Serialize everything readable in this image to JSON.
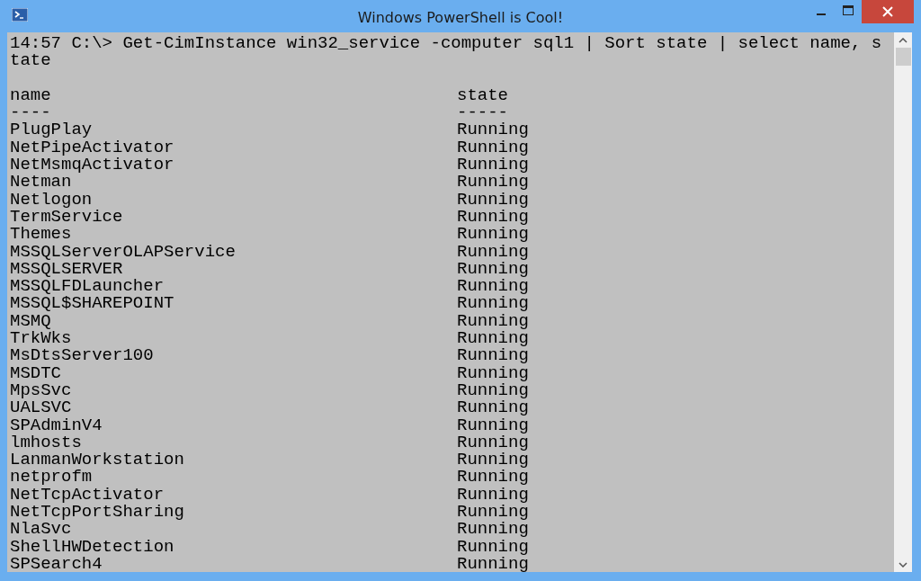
{
  "window": {
    "title": "Windows PowerShell is Cool!"
  },
  "command_lines": [
    "14:57 C:\\> Get-CimInstance win32_service -computer sql1 | Sort state | select name, s",
    "tate"
  ],
  "columns": [
    {
      "header": "name",
      "underline": "----"
    },
    {
      "header": "state",
      "underline": "-----"
    }
  ],
  "rows": [
    {
      "name": "PlugPlay",
      "state": "Running"
    },
    {
      "name": "NetPipeActivator",
      "state": "Running"
    },
    {
      "name": "NetMsmqActivator",
      "state": "Running"
    },
    {
      "name": "Netman",
      "state": "Running"
    },
    {
      "name": "Netlogon",
      "state": "Running"
    },
    {
      "name": "TermService",
      "state": "Running"
    },
    {
      "name": "Themes",
      "state": "Running"
    },
    {
      "name": "MSSQLServerOLAPService",
      "state": "Running"
    },
    {
      "name": "MSSQLSERVER",
      "state": "Running"
    },
    {
      "name": "MSSQLFDLauncher",
      "state": "Running"
    },
    {
      "name": "MSSQL$SHAREPOINT",
      "state": "Running"
    },
    {
      "name": "MSMQ",
      "state": "Running"
    },
    {
      "name": "TrkWks",
      "state": "Running"
    },
    {
      "name": "MsDtsServer100",
      "state": "Running"
    },
    {
      "name": "MSDTC",
      "state": "Running"
    },
    {
      "name": "MpsSvc",
      "state": "Running"
    },
    {
      "name": "UALSVC",
      "state": "Running"
    },
    {
      "name": "SPAdminV4",
      "state": "Running"
    },
    {
      "name": "lmhosts",
      "state": "Running"
    },
    {
      "name": "LanmanWorkstation",
      "state": "Running"
    },
    {
      "name": "netprofm",
      "state": "Running"
    },
    {
      "name": "NetTcpActivator",
      "state": "Running"
    },
    {
      "name": "NetTcpPortSharing",
      "state": "Running"
    },
    {
      "name": "NlaSvc",
      "state": "Running"
    },
    {
      "name": "ShellHWDetection",
      "state": "Running"
    },
    {
      "name": "SPSearch4",
      "state": "Running"
    }
  ]
}
